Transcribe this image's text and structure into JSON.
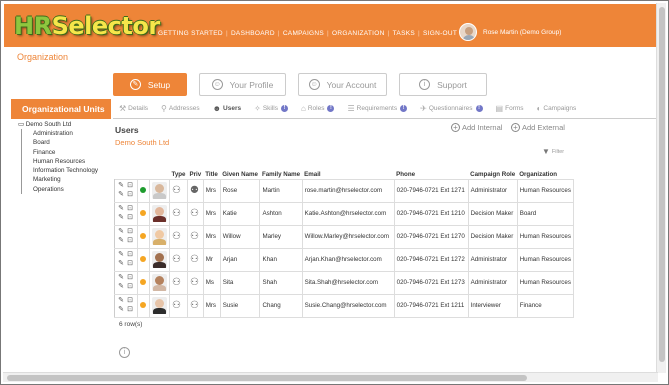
{
  "app": {
    "logo_hr": "HR",
    "logo_selector": "Selector"
  },
  "topnav": {
    "items": [
      "GETTING STARTED",
      "DASHBOARD",
      "CAMPAIGNS",
      "ORGANIZATION",
      "TASKS",
      "SIGN-OUT"
    ],
    "active": "ORGANIZATION",
    "separator": "|"
  },
  "user": {
    "name": "Rose Martin (Demo Group)"
  },
  "page": {
    "title": "Organization"
  },
  "tabs": [
    {
      "label": "Setup",
      "icon": "wrench-icon",
      "active": true
    },
    {
      "label": "Your Profile",
      "icon": "person-icon",
      "active": false
    },
    {
      "label": "Your Account",
      "icon": "person-icon",
      "active": false
    },
    {
      "label": "Support",
      "icon": "info-icon",
      "active": false
    }
  ],
  "left_panel": {
    "title": "Organizational Units",
    "root": "Demo South Ltd",
    "children": [
      "Administration",
      "Board",
      "Finance",
      "Human Resources",
      "Information Technology",
      "Marketing",
      "Operations"
    ]
  },
  "subtabs": [
    {
      "label": "Details",
      "icon": "tools-icon",
      "badge": ""
    },
    {
      "label": "Addresses",
      "icon": "map-pin-icon",
      "badge": ""
    },
    {
      "label": "Users",
      "icon": "users-icon",
      "badge": "",
      "active": true
    },
    {
      "label": "Skills",
      "icon": "skills-icon",
      "badge": "!"
    },
    {
      "label": "Roles",
      "icon": "hat-icon",
      "badge": "!"
    },
    {
      "label": "Requirements",
      "icon": "list-icon",
      "badge": "!"
    },
    {
      "label": "Questionnaires",
      "icon": "questionnaire-icon",
      "badge": "!"
    },
    {
      "label": "Forms",
      "icon": "form-icon",
      "badge": ""
    },
    {
      "label": "Campaigns",
      "icon": "campaign-icon",
      "badge": ""
    }
  ],
  "users_section": {
    "heading": "Users",
    "org": "Demo South Ltd",
    "add_internal": "Add Internal",
    "add_external": "Add External",
    "filter": "Filter"
  },
  "table": {
    "columns": [
      "",
      "",
      "",
      "Type",
      "Priv",
      "Title",
      "Given Name",
      "Family Name",
      "Email",
      "Phone",
      "Campaign Role",
      "Organization"
    ],
    "rows": [
      {
        "status": "green",
        "title": "Mrs",
        "given": "Rose",
        "family": "Martin",
        "email": "rose.martin@hrselector.com",
        "phone": "020-7946-0721 Ext 1271",
        "role": "Administrator",
        "org": "Human Resources",
        "skin": "#d9b89c",
        "shirt": "#c9c9c9"
      },
      {
        "status": "orange",
        "title": "Mrs",
        "given": "Katie",
        "family": "Ashton",
        "email": "Katie.Ashton@hrselector.com",
        "phone": "020-7946-0721 Ext 1210",
        "role": "Decision Maker",
        "org": "Board",
        "skin": "#e2b69a",
        "shirt": "#6b2f2a"
      },
      {
        "status": "orange",
        "title": "Mrs",
        "given": "Willow",
        "family": "Marley",
        "email": "Willow.Marley@hrselector.com",
        "phone": "020-7946-0721 Ext 1270",
        "role": "Decision Maker",
        "org": "Human Resources",
        "skin": "#f0c9a3",
        "shirt": "#d8b06a"
      },
      {
        "status": "orange",
        "title": "Mr",
        "given": "Arjan",
        "family": "Khan",
        "email": "Arjan.Khan@hrselector.com",
        "phone": "020-7946-0721 Ext 1272",
        "role": "Administrator",
        "org": "Human Resources",
        "skin": "#a2714f",
        "shirt": "#3a2c2a"
      },
      {
        "status": "orange",
        "title": "Ms",
        "given": "Sita",
        "family": "Shah",
        "email": "Sita.Shah@hrselector.com",
        "phone": "020-7946-0721 Ext 1273",
        "role": "Administrator",
        "org": "Human Resources",
        "skin": "#b5825e",
        "shirt": "#d2b7a4"
      },
      {
        "status": "orange",
        "title": "Mrs",
        "given": "Susie",
        "family": "Chang",
        "email": "Susie.Chang@hrselector.com",
        "phone": "020-7946-0721 Ext 1211",
        "role": "Interviewer",
        "org": "Finance",
        "skin": "#e7c4a8",
        "shirt": "#2d2d2d"
      }
    ],
    "row_count": "6 row(s)"
  },
  "colors": {
    "accent": "#ee8538",
    "green": "#1e9c2e",
    "orange": "#f5a623",
    "badge": "#7277c7"
  }
}
